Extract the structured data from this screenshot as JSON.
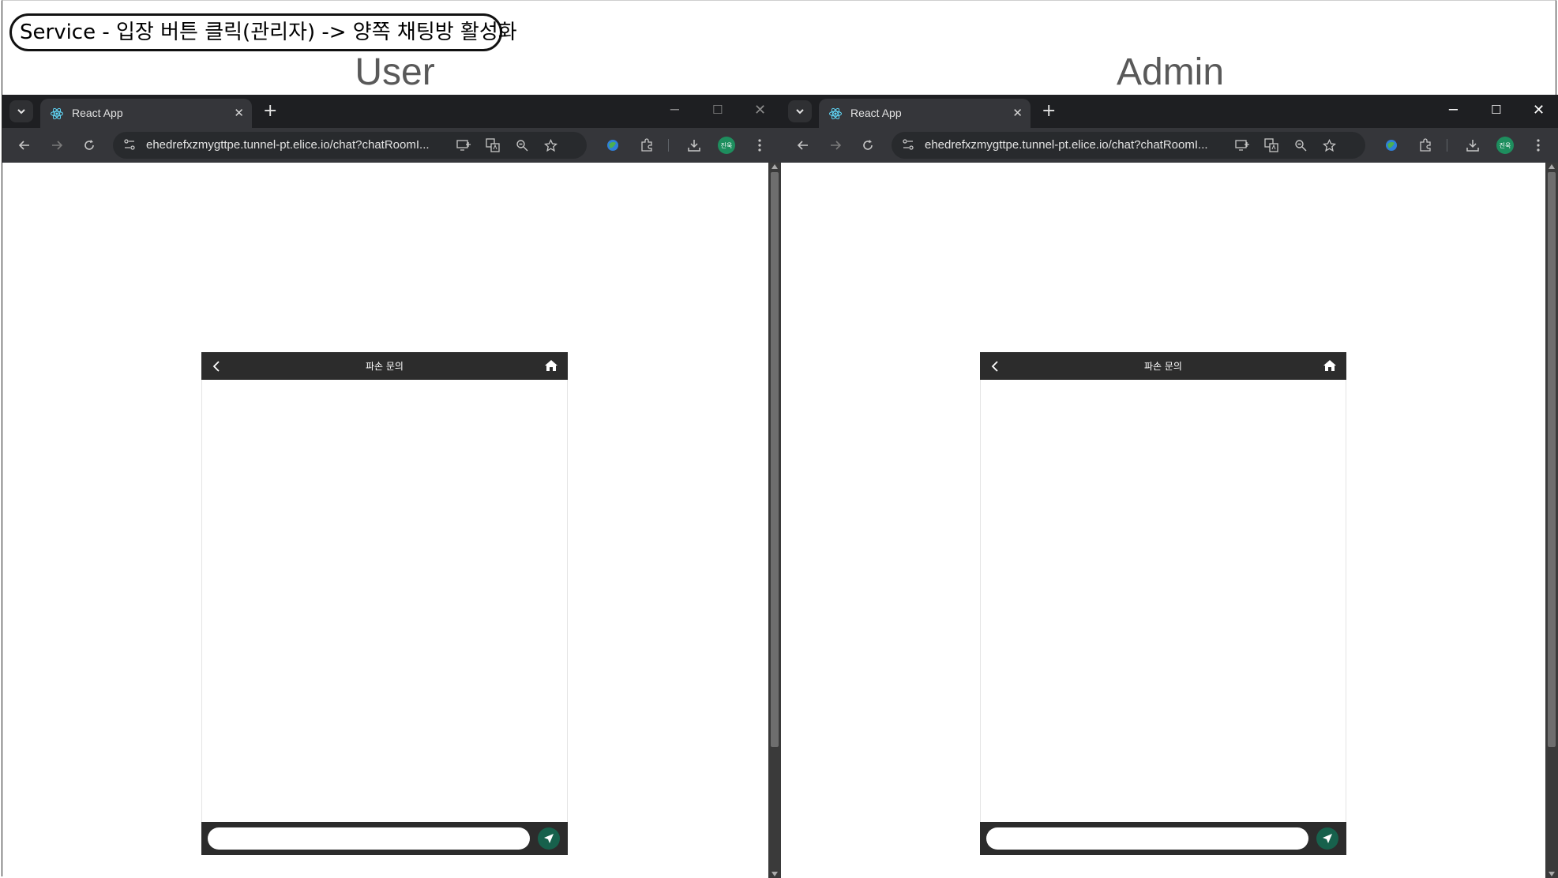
{
  "caption": "Service - 입장 버튼 클릭(관리자) -> 양쪽 채팅방 활성화",
  "panels": [
    {
      "label": "User",
      "tab_title": "React App",
      "url": "ehedrefxzmygttpe.tunnel-pt.elice.io/chat?chatRoomI...",
      "profile_badge": "진욱",
      "chat_title": "파손 문의",
      "message_placeholder": ""
    },
    {
      "label": "Admin",
      "tab_title": "React App",
      "url": "ehedrefxzmygttpe.tunnel-pt.elice.io/chat?chatRoomI...",
      "profile_badge": "진욱",
      "chat_title": "파손 문의",
      "message_placeholder": ""
    }
  ],
  "colors": {
    "tabbar": "#1e1f22",
    "toolbar": "#35363a",
    "chat_bar": "#2c2c2c",
    "send_button": "#17614c",
    "avatar": "#1e8e5e"
  },
  "icons": [
    "tab-search-icon",
    "react-icon",
    "close-icon",
    "plus-icon",
    "minimize-icon",
    "maximize-icon",
    "back-icon",
    "forward-icon",
    "reload-icon",
    "site-info-icon",
    "install-icon",
    "translate-icon",
    "zoom-icon",
    "star-icon",
    "extension-icon",
    "puzzle-icon",
    "download-icon",
    "menu-icon",
    "chevron-left-icon",
    "home-icon",
    "send-icon"
  ]
}
